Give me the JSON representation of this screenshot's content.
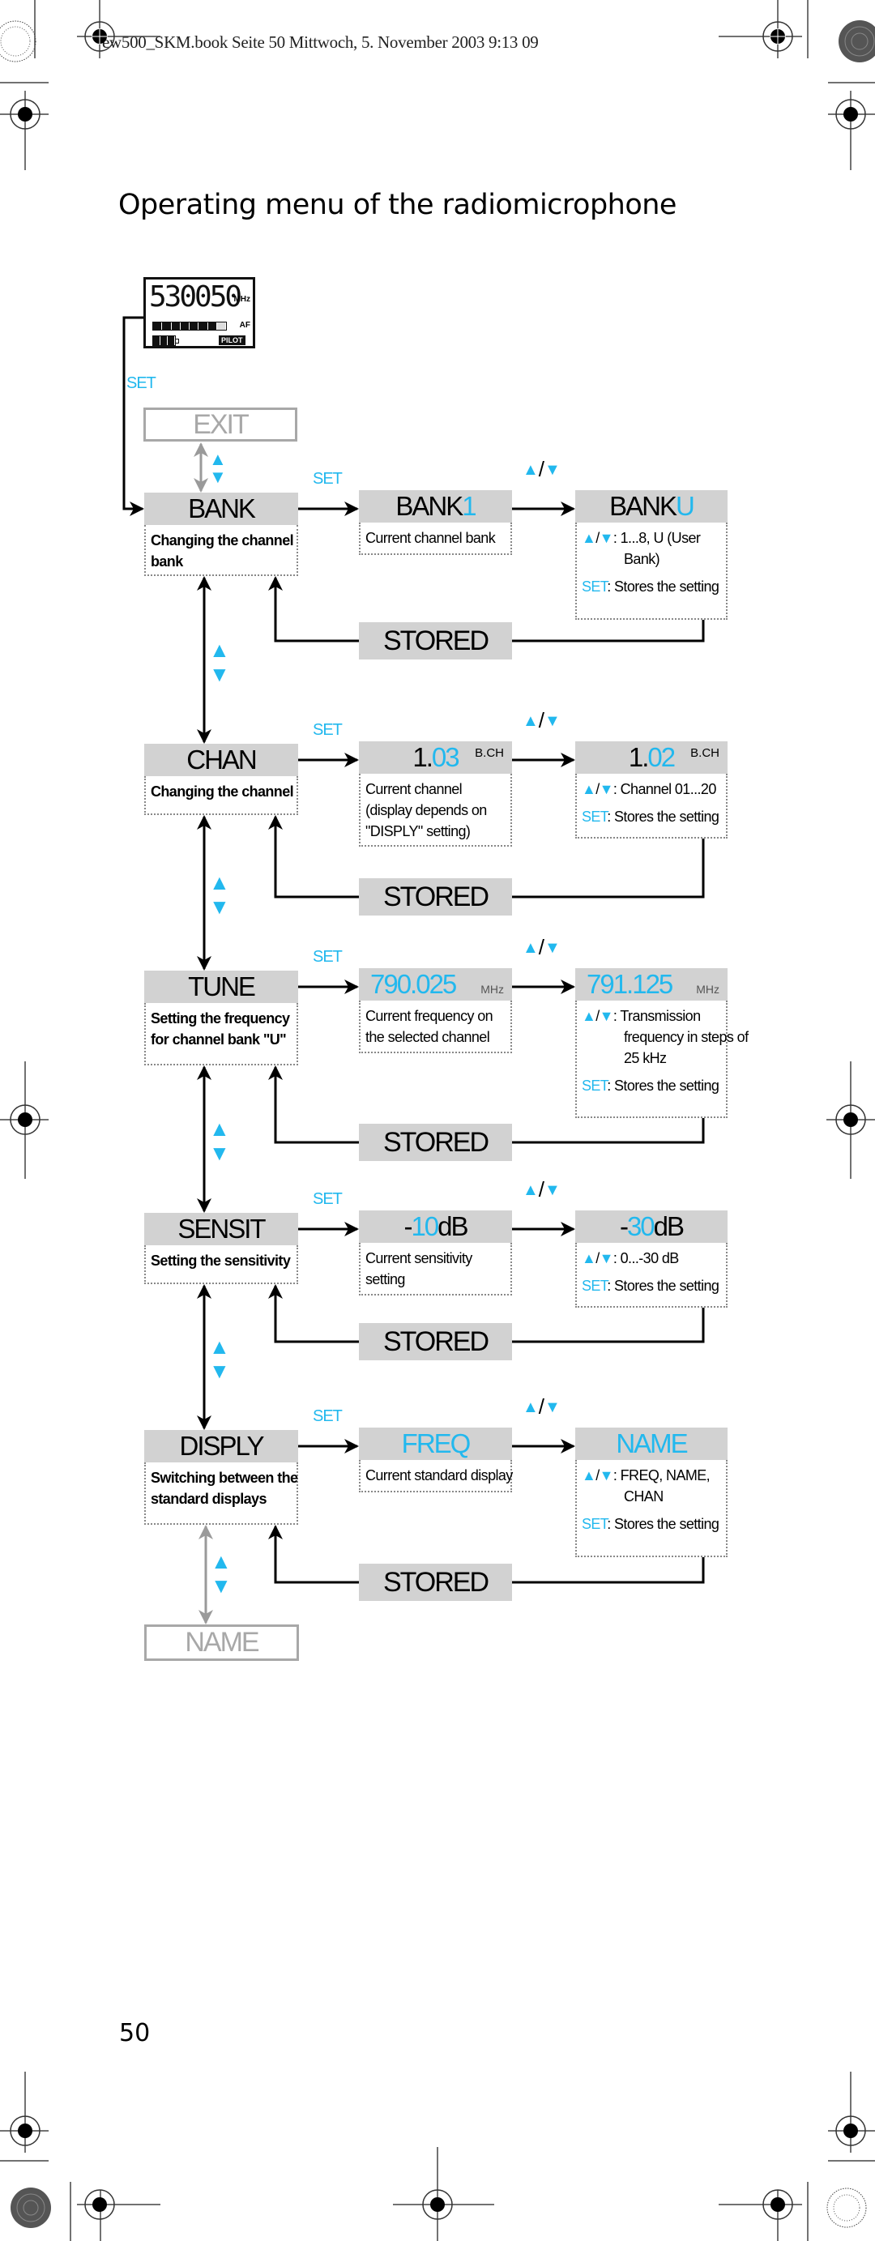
{
  "print_header": "ew500_SKM.book  Seite 50  Mittwoch, 5. November 2003  9:13 09",
  "title": "Operating menu of the radiomicrophone",
  "page_number": "50",
  "colors": {
    "accent_blue": "#22b8ee",
    "header_gray": "#d2d2d2",
    "ghost_gray": "#a8a8a8"
  },
  "lcd": {
    "digits": "530050",
    "unit": "MHz",
    "af_label": "AF",
    "pilot_label": "PILOT",
    "af_level_segments_on": 7,
    "af_level_segments_total": 8,
    "battery_segments": 3
  },
  "entry_label": "SET",
  "exit_label": "EXIT",
  "end_label": "NAME",
  "stored_label": "STORED",
  "set_label": "SET",
  "updown_symbol": "▲/▼",
  "store_note_key": "SET",
  "store_note_text": ": Stores the setting",
  "menu": [
    {
      "name": "BANK",
      "description": [
        "Changing the channel",
        "bank"
      ],
      "current": {
        "prefix": "BANK ",
        "value": "1",
        "suffix": "",
        "unit": ""
      },
      "new": {
        "prefix": "BANK ",
        "value": "U",
        "suffix": "",
        "unit": ""
      },
      "current_desc": [
        "Current channel bank"
      ],
      "new_desc": [
        ": 1...8, U (User",
        "Bank)"
      ]
    },
    {
      "name": "CHAN",
      "description": [
        "Changing the channel"
      ],
      "current": {
        "prefix": "1.",
        "value": "03",
        "suffix": "",
        "unit": "B.CH"
      },
      "new": {
        "prefix": "1.",
        "value": "02",
        "suffix": "",
        "unit": "B.CH"
      },
      "current_desc": [
        "Current channel",
        "(display depends on",
        "\"DISPLY\" setting)"
      ],
      "new_desc": [
        ": Channel  01...20"
      ]
    },
    {
      "name": "TUNE",
      "description": [
        "Setting the frequency",
        "for channel bank \"U\""
      ],
      "current": {
        "prefix": "",
        "value": "790.025",
        "suffix": "",
        "unit": "MHz"
      },
      "new": {
        "prefix": "",
        "value": "791.125",
        "suffix": "",
        "unit": "MHz"
      },
      "current_desc": [
        "Current frequency on",
        "the selected channel"
      ],
      "new_desc": [
        ": Transmission",
        "frequency in steps of",
        "25 kHz"
      ]
    },
    {
      "name": "SENSIT",
      "description": [
        "Setting the sensitivity"
      ],
      "current": {
        "prefix": "-",
        "value": "10",
        "suffix": " dB",
        "unit": ""
      },
      "new": {
        "prefix": "-",
        "value": "30",
        "suffix": " dB",
        "unit": ""
      },
      "current_desc": [
        "Current sensitivity",
        "setting"
      ],
      "new_desc": [
        ":  0...-30 dB"
      ]
    },
    {
      "name": "DISPLY",
      "description": [
        "Switching between the",
        "standard displays"
      ],
      "current": {
        "prefix": "",
        "value": "FREQ",
        "suffix": "",
        "unit": ""
      },
      "new": {
        "prefix": "",
        "value": "NAME",
        "suffix": "",
        "unit": ""
      },
      "current_desc": [
        "Current standard display"
      ],
      "new_desc": [
        ":  FREQ, NAME,",
        "CHAN"
      ]
    }
  ]
}
